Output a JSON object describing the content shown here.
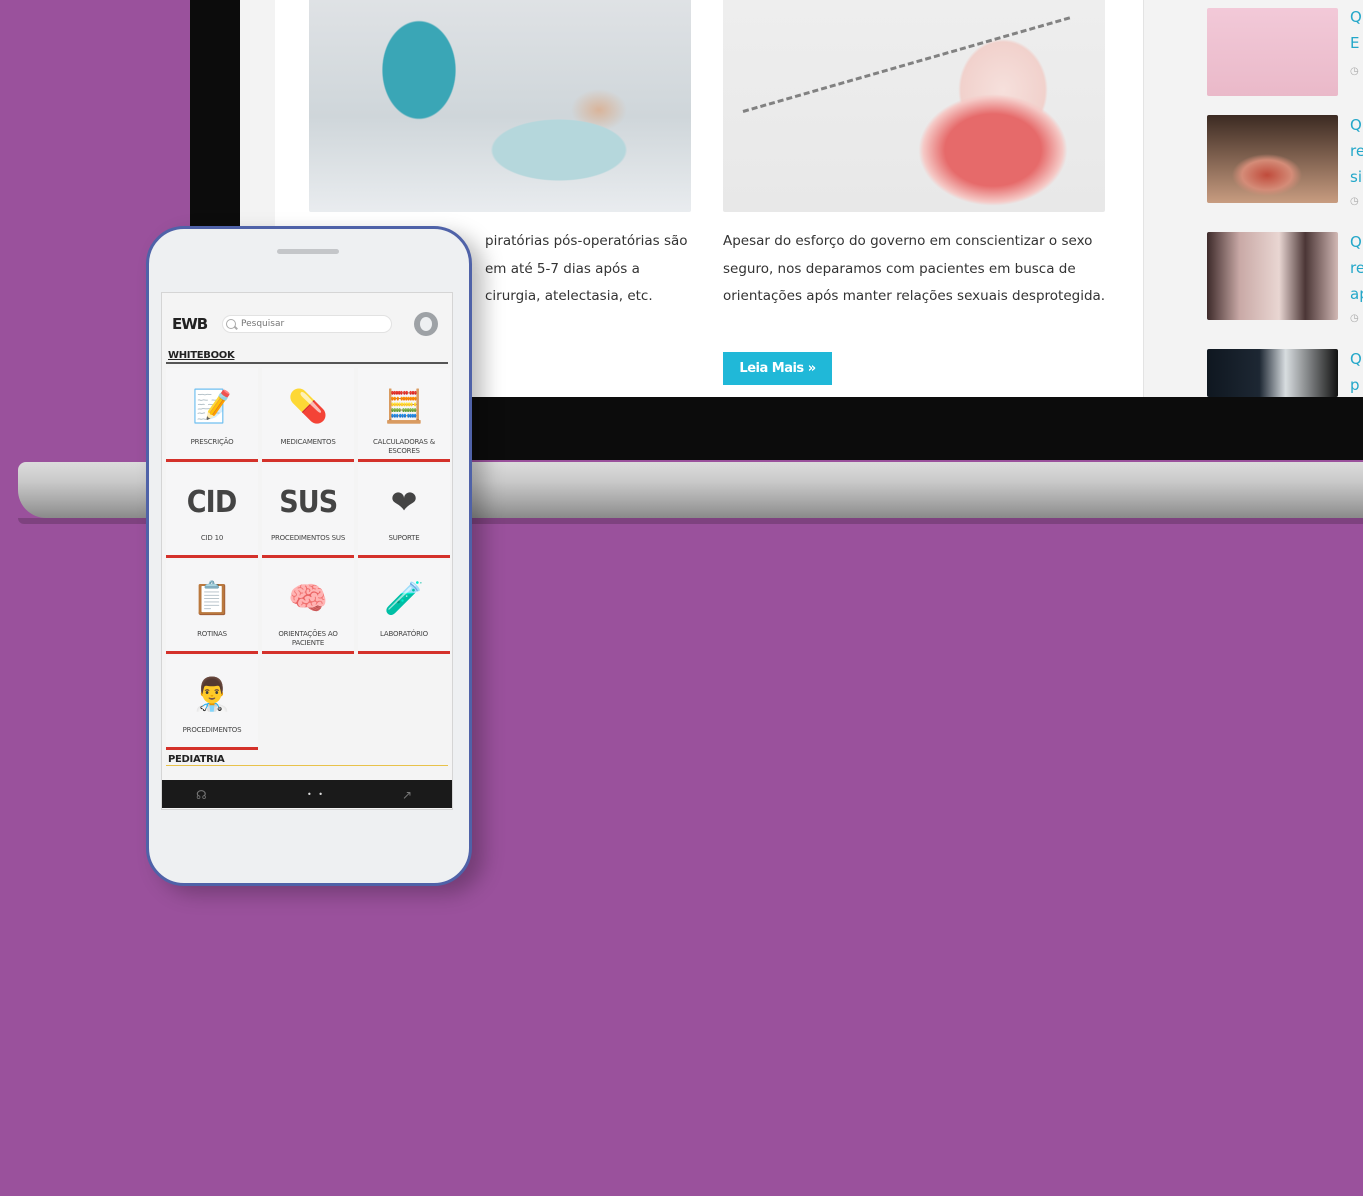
{
  "laptop": {
    "articles": [
      {
        "text": "piratórias pós-operatórias são em até 5-7 dias após a cirurgia, atelectasia, etc."
      },
      {
        "text": "Apesar do esforço do governo em conscientizar o sexo seguro, nos deparamos com pacientes em busca de orientações após manter relações sexuais desprotegida.",
        "button": "Leia Mais »"
      }
    ],
    "sidebar": [
      {
        "line1": "Q",
        "line2": "E"
      },
      {
        "line1": "Q",
        "line2": "re",
        "line3": "si"
      },
      {
        "line1": "Q",
        "line2": "re",
        "line3": "ap"
      },
      {
        "line1": "Q",
        "line2": "p"
      }
    ]
  },
  "phone": {
    "logo": "EWB",
    "search_placeholder": "Pesquisar",
    "section_whitebook": "WHITEBOOK",
    "section_pediatria": "PEDIATRIA",
    "tiles": [
      {
        "label": "PRESCRIÇÃO",
        "icon": "prescription-icon",
        "glyph": "📝"
      },
      {
        "label": "MEDICAMENTOS",
        "icon": "pill-icon",
        "glyph": "💊"
      },
      {
        "label": "CALCULADORAS & ESCORES",
        "icon": "calculator-icon",
        "glyph": "🧮"
      },
      {
        "label": "CID 10",
        "icon": "cid-icon",
        "glyph": "CID"
      },
      {
        "label": "PROCEDIMENTOS SUS",
        "icon": "sus-icon",
        "glyph": "SUS"
      },
      {
        "label": "SUPORTE",
        "icon": "support-heart-icon",
        "glyph": "❤"
      },
      {
        "label": "ROTINAS",
        "icon": "clipboard-icon",
        "glyph": "📋"
      },
      {
        "label": "ORIENTAÇÕES AO PACIENTE",
        "icon": "head-icon",
        "glyph": "🧠"
      },
      {
        "label": "LABORATÓRIO",
        "icon": "lab-tube-icon",
        "glyph": "🧪"
      },
      {
        "label": "PROCEDIMENTOS",
        "icon": "doctor-icon",
        "glyph": "👨‍⚕️"
      }
    ]
  }
}
